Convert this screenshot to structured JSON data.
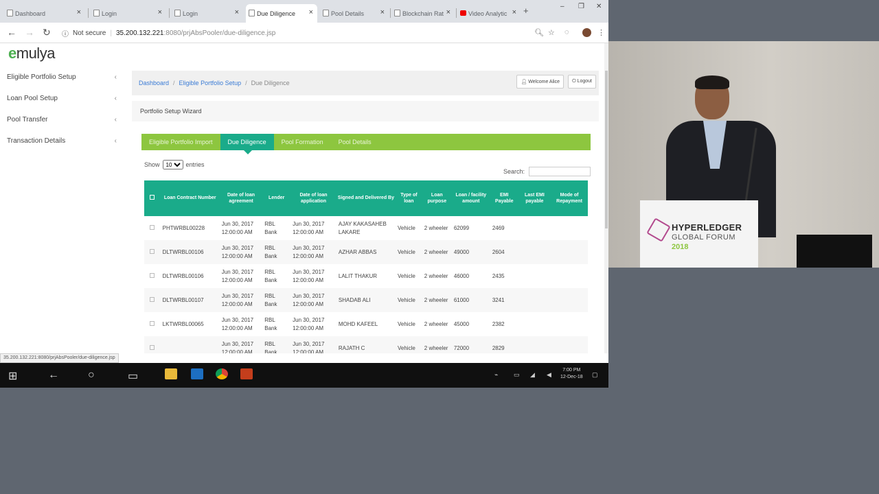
{
  "browser": {
    "tabs": [
      {
        "label": "Dashboard",
        "active": false,
        "x": 0
      },
      {
        "label": "Login",
        "active": false
      },
      {
        "label": "Login",
        "active": false
      },
      {
        "label": "Due Diligence",
        "active": true
      },
      {
        "label": "Pool Details",
        "active": false
      },
      {
        "label": "Blockchain Rat",
        "active": false
      },
      {
        "label": "Video Analytic",
        "active": false
      }
    ],
    "security": "Not secure",
    "url_host": "35.200.132.221",
    "url_path": ":8080/prjAbsPooler/due-diligence.jsp",
    "status_url": "35.200.132.221:8080/prjAbsPooler/due-diligence.jsp"
  },
  "app": {
    "logo_e": "e",
    "logo_rest": "mulya",
    "sidebar": [
      {
        "label": "Eligible Portfolio Setup"
      },
      {
        "label": "Loan Pool Setup"
      },
      {
        "label": "Pool Transfer"
      },
      {
        "label": "Transaction Details"
      }
    ],
    "breadcrumb": {
      "home": "Dashboard",
      "parent": "Eligible Portfolio Setup",
      "current": "Due Diligence",
      "sep": "/"
    },
    "welcome": "Welcome Alice",
    "logout": "Logout",
    "wizard_title": "Portfolio Setup Wizard",
    "wizard_tabs": [
      "Eligible Portfolio Import",
      "Due Diligence",
      "Pool Formation",
      "Pool Details"
    ],
    "show_label": "Show",
    "show_value": "10",
    "entries_label": "entries",
    "search_label": "Search:"
  },
  "table": {
    "headers": [
      "Loan Contract Number",
      "Date of loan agreement",
      "Lender",
      "Date of loan application",
      "Signed and Delivered By",
      "Type of loan",
      "Loan purpose",
      "Loan / facility amount",
      "EMI Payable",
      "Last EMI payable",
      "Mode of Repayment"
    ],
    "rows": [
      [
        "PHTWRBL00228",
        "Jun 30, 2017 12:00:00 AM",
        "RBL Bank",
        "Jun 30, 2017 12:00:00 AM",
        "AJAY KAKASAHEB LAKARE",
        "Vehicle",
        "2 wheeler",
        "62099",
        "2469",
        "",
        ""
      ],
      [
        "DLTWRBL00106",
        "Jun 30, 2017 12:00:00 AM",
        "RBL Bank",
        "Jun 30, 2017 12:00:00 AM",
        "AZHAR ABBAS",
        "Vehicle",
        "2 wheeler",
        "49000",
        "2604",
        "",
        ""
      ],
      [
        "DLTWRBL00106",
        "Jun 30, 2017 12:00:00 AM",
        "RBL Bank",
        "Jun 30, 2017 12:00:00 AM",
        "LALIT THAKUR",
        "Vehicle",
        "2 wheeler",
        "46000",
        "2435",
        "",
        ""
      ],
      [
        "DLTWRBL00107",
        "Jun 30, 2017 12:00:00 AM",
        "RBL Bank",
        "Jun 30, 2017 12:00:00 AM",
        "SHADAB ALI",
        "Vehicle",
        "2 wheeler",
        "61000",
        "3241",
        "",
        ""
      ],
      [
        "LKTWRBL00065",
        "Jun 30, 2017 12:00:00 AM",
        "RBL Bank",
        "Jun 30, 2017 12:00:00 AM",
        "MOHD KAFEEL",
        "Vehicle",
        "2 wheeler",
        "45000",
        "2382",
        "",
        ""
      ],
      [
        "",
        "Jun 30, 2017 12:00:00 AM",
        "RBL Bank",
        "Jun 30, 2017 12:00:00 AM",
        "RAJATH C",
        "Vehicle",
        "2 wheeler",
        "72000",
        "2829",
        "",
        ""
      ]
    ]
  },
  "taskbar": {
    "time": "7:00 PM",
    "date": "12-Dec-18"
  },
  "stage": {
    "podium_line1": "HYPERLEDGER",
    "podium_line2": "GLOBAL FORUM",
    "podium_line3": "2018"
  },
  "colors": {
    "accent": "#1aab8a",
    "wizard_bar": "#8dc63f",
    "link": "#3a7bd5"
  }
}
